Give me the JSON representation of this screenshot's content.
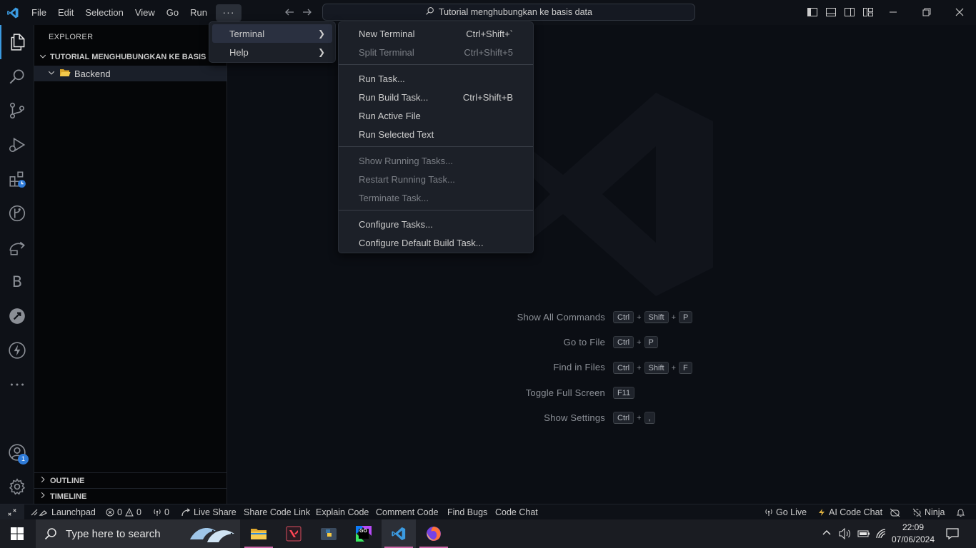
{
  "titlebar": {
    "menus": [
      "File",
      "Edit",
      "Selection",
      "View",
      "Go",
      "Run"
    ],
    "more_label": "···",
    "search_text": "Tutorial menghubungkan ke basis data"
  },
  "sidebar": {
    "title": "EXPLORER",
    "root_folder": "TUTORIAL MENGHUBUNGKAN KE BASIS DA",
    "folder_item": "Backend",
    "outline": "OUTLINE",
    "timeline": "TIMELINE"
  },
  "activity": {
    "accounts_badge": "1",
    "b_letter": "B"
  },
  "overflow_menu": {
    "items": [
      {
        "label": "Terminal"
      },
      {
        "label": "Help"
      }
    ]
  },
  "terminal_menu": {
    "items": [
      {
        "label": "New Terminal",
        "shortcut": "Ctrl+Shift+`"
      },
      {
        "label": "Split Terminal",
        "shortcut": "Ctrl+Shift+5"
      },
      {
        "label": "Run Task..."
      },
      {
        "label": "Run Build Task...",
        "shortcut": "Ctrl+Shift+B"
      },
      {
        "label": "Run Active File"
      },
      {
        "label": "Run Selected Text"
      },
      {
        "label": "Show Running Tasks..."
      },
      {
        "label": "Restart Running Task..."
      },
      {
        "label": "Terminate Task..."
      },
      {
        "label": "Configure Tasks..."
      },
      {
        "label": "Configure Default Build Task..."
      }
    ]
  },
  "hints": [
    {
      "label": "Show All Commands",
      "keys": [
        "Ctrl",
        "Shift",
        "P"
      ]
    },
    {
      "label": "Go to File",
      "keys": [
        "Ctrl",
        "P"
      ]
    },
    {
      "label": "Find in Files",
      "keys": [
        "Ctrl",
        "Shift",
        "F"
      ]
    },
    {
      "label": "Toggle Full Screen",
      "keys": [
        "F11"
      ]
    },
    {
      "label": "Show Settings",
      "keys": [
        "Ctrl",
        ","
      ]
    }
  ],
  "hint_plus": "+",
  "statusbar": {
    "launchpad": "Launchpad",
    "errors": "0",
    "warnings": "0",
    "ports": "0",
    "live_share": "Live Share",
    "share_code_link": "Share Code Link",
    "explain_code": "Explain Code",
    "comment_code": "Comment Code",
    "find_bugs": "Find Bugs",
    "code_chat": "Code Chat",
    "go_live": "Go Live",
    "ai_code_chat": "AI Code Chat",
    "ninja": "Ninja"
  },
  "taskbar": {
    "search_placeholder": "Type here to search",
    "time": "22:09",
    "date": "07/06/2024",
    "go_label": "GO"
  },
  "colors": {
    "accent_vscode": "#3b9ae0",
    "taskbar_underline": "#cc68a8",
    "badge": "#2f7bd8"
  }
}
